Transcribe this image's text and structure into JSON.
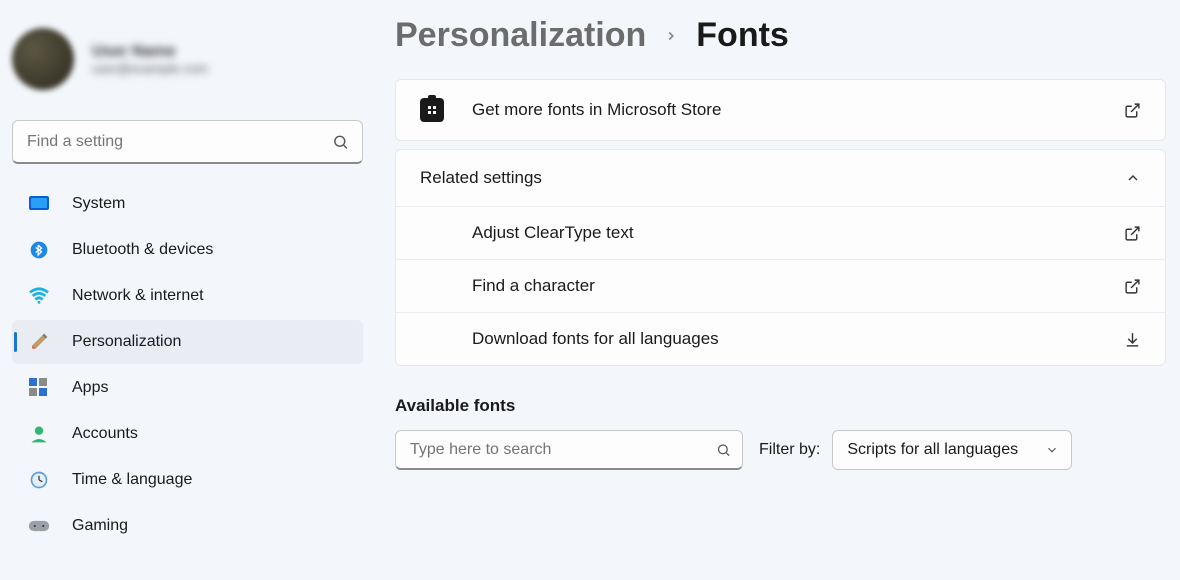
{
  "profile": {
    "name": "User Name",
    "email": "user@example.com"
  },
  "search": {
    "placeholder": "Find a setting"
  },
  "sidebar": {
    "items": [
      {
        "label": "System",
        "icon": "monitor"
      },
      {
        "label": "Bluetooth & devices",
        "icon": "bluetooth"
      },
      {
        "label": "Network & internet",
        "icon": "wifi"
      },
      {
        "label": "Personalization",
        "icon": "paintbrush",
        "active": true
      },
      {
        "label": "Apps",
        "icon": "apps"
      },
      {
        "label": "Accounts",
        "icon": "person"
      },
      {
        "label": "Time & language",
        "icon": "clock"
      },
      {
        "label": "Gaming",
        "icon": "gamepad"
      }
    ]
  },
  "breadcrumb": {
    "parent": "Personalization",
    "current": "Fonts"
  },
  "cards": {
    "store": "Get more fonts in Microsoft Store",
    "related_header": "Related settings",
    "cleartype": "Adjust ClearType text",
    "find_char": "Find a character",
    "download_fonts": "Download fonts for all languages"
  },
  "available": {
    "title": "Available fonts",
    "search_placeholder": "Type here to search",
    "filter_label": "Filter by:",
    "filter_value": "Scripts for all languages"
  }
}
